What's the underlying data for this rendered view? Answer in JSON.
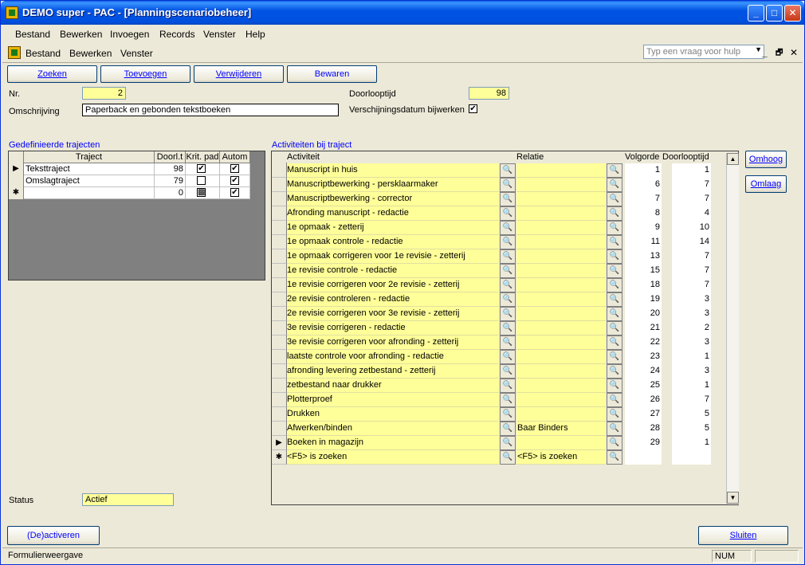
{
  "window": {
    "title": "DEMO super - PAC - [Planningscenariobeheer]",
    "minimize": "_",
    "maximize": "□",
    "close": "✕"
  },
  "menu": [
    "Bestand",
    "Bewerken",
    "Invoegen",
    "Records",
    "Venster",
    "Help"
  ],
  "menu2": [
    "Bestand",
    "Bewerken",
    "Venster"
  ],
  "help_placeholder": "Typ een vraag voor hulp",
  "mdi_controls": {
    "minimize": "_",
    "restore": "🗗",
    "close": "✕"
  },
  "toolbar": {
    "zoeken": "Zoeken",
    "toevoegen": "Toevoegen",
    "verwijderen": "Verwijderen",
    "bewaren": "Bewaren"
  },
  "form": {
    "nr_label": "Nr.",
    "nr_value": "2",
    "omschrijving_label": "Omschrijving",
    "omschrijving_value": "Paperback en gebonden tekstboeken",
    "doorlooptijd_label": "Doorlooptijd",
    "doorlooptijd_value": "98",
    "verschijningsdatum_label": "Verschijningsdatum bijwerken",
    "verschijningsdatum_checked": true,
    "status_label": "Status",
    "status_value": "Actief"
  },
  "trajecten": {
    "title": "Gedefinieerde trajecten",
    "headers": [
      "Traject",
      "Doorl.t",
      "Krit. pad",
      "Autom"
    ],
    "rows": [
      {
        "marker": "▶",
        "traject": "Teksttraject",
        "doorl": "98",
        "krit": "✔",
        "autom": "✔"
      },
      {
        "marker": "",
        "traject": "Omslagtraject",
        "doorl": "79",
        "krit": "",
        "autom": "✔"
      },
      {
        "marker": "✱",
        "traject": "",
        "doorl": "0",
        "krit": "▩",
        "autom": "✔"
      }
    ]
  },
  "activiteiten": {
    "title": "Activiteiten bij traject",
    "headers": {
      "activiteit": "Activiteit",
      "relatie": "Relatie",
      "volgorde": "Volgorde",
      "doorlooptijd": "Doorlooptijd"
    },
    "rows": [
      {
        "marker": "",
        "activiteit": "Manuscript in huis",
        "relatie": "",
        "volgorde": "1",
        "doorlooptijd": "1"
      },
      {
        "marker": "",
        "activiteit": "Manuscriptbewerking - persklaarmaker",
        "relatie": "",
        "volgorde": "6",
        "doorlooptijd": "7"
      },
      {
        "marker": "",
        "activiteit": "Manuscriptbewerking - corrector",
        "relatie": "",
        "volgorde": "7",
        "doorlooptijd": "7"
      },
      {
        "marker": "",
        "activiteit": "Afronding manuscript - redactie",
        "relatie": "",
        "volgorde": "8",
        "doorlooptijd": "4"
      },
      {
        "marker": "",
        "activiteit": "1e opmaak - zetterij",
        "relatie": "",
        "volgorde": "9",
        "doorlooptijd": "10"
      },
      {
        "marker": "",
        "activiteit": "1e opmaak controle - redactie",
        "relatie": "",
        "volgorde": "11",
        "doorlooptijd": "14"
      },
      {
        "marker": "",
        "activiteit": "1e opmaak corrigeren voor 1e revisie - zetterij",
        "relatie": "",
        "volgorde": "13",
        "doorlooptijd": "7"
      },
      {
        "marker": "",
        "activiteit": "1e revisie controle - redactie",
        "relatie": "",
        "volgorde": "15",
        "doorlooptijd": "7"
      },
      {
        "marker": "",
        "activiteit": "1e revisie corrigeren voor 2e revisie - zetterij",
        "relatie": "",
        "volgorde": "18",
        "doorlooptijd": "7"
      },
      {
        "marker": "",
        "activiteit": "2e revisie controleren - redactie",
        "relatie": "",
        "volgorde": "19",
        "doorlooptijd": "3"
      },
      {
        "marker": "",
        "activiteit": "2e revisie corrigeren voor 3e revisie - zetterij",
        "relatie": "",
        "volgorde": "20",
        "doorlooptijd": "3"
      },
      {
        "marker": "",
        "activiteit": "3e revisie corrigeren - redactie",
        "relatie": "",
        "volgorde": "21",
        "doorlooptijd": "2"
      },
      {
        "marker": "",
        "activiteit": "3e revisie corrigeren voor afronding - zetterij",
        "relatie": "",
        "volgorde": "22",
        "doorlooptijd": "3"
      },
      {
        "marker": "",
        "activiteit": "laatste controle voor afronding - redactie",
        "relatie": "",
        "volgorde": "23",
        "doorlooptijd": "1"
      },
      {
        "marker": "",
        "activiteit": "afronding levering zetbestand - zetterij",
        "relatie": "",
        "volgorde": "24",
        "doorlooptijd": "3"
      },
      {
        "marker": "",
        "activiteit": "zetbestand naar drukker",
        "relatie": "",
        "volgorde": "25",
        "doorlooptijd": "1"
      },
      {
        "marker": "",
        "activiteit": "Plotterproef",
        "relatie": "",
        "volgorde": "26",
        "doorlooptijd": "7"
      },
      {
        "marker": "",
        "activiteit": "Drukken",
        "relatie": "",
        "volgorde": "27",
        "doorlooptijd": "5"
      },
      {
        "marker": "",
        "activiteit": "Afwerken/binden",
        "relatie": "Baar Binders",
        "volgorde": "28",
        "doorlooptijd": "5"
      },
      {
        "marker": "▶",
        "activiteit": "Boeken in magazijn",
        "relatie": "",
        "volgorde": "29",
        "doorlooptijd": "1"
      },
      {
        "marker": "✱",
        "activiteit": "<F5> is zoeken",
        "relatie": "<F5> is zoeken",
        "volgorde": "",
        "doorlooptijd": ""
      }
    ]
  },
  "side_buttons": {
    "omhoog": "Omhoog",
    "omlaag": "Omlaag"
  },
  "bottom": {
    "deactiveren": "(De)activeren",
    "sluiten": "Sluiten"
  },
  "statusbar": {
    "left": "Formulierweergave",
    "num": "NUM"
  }
}
